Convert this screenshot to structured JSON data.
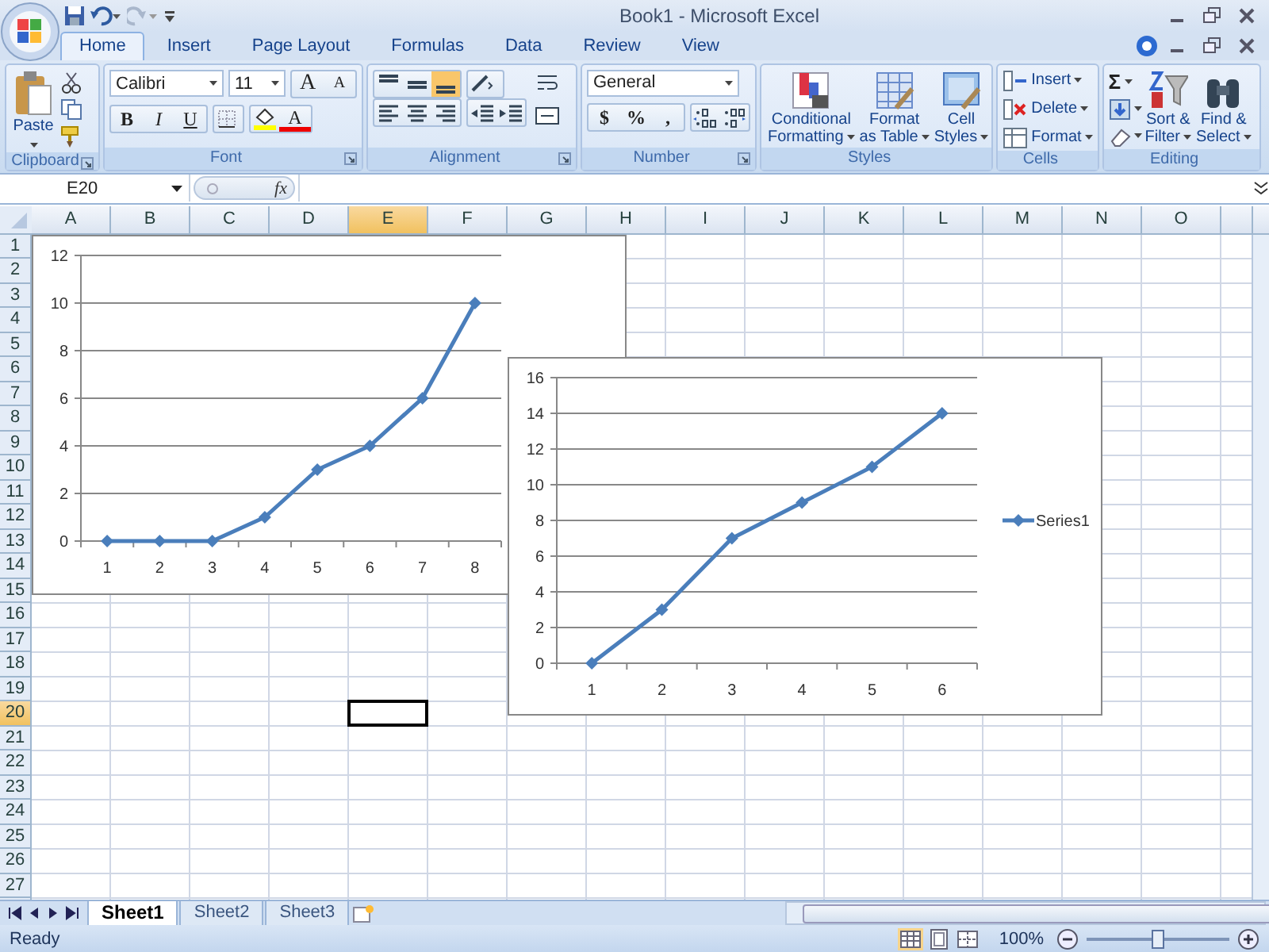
{
  "window": {
    "title": "Book1 - Microsoft Excel"
  },
  "ribbon_tabs": [
    {
      "label": "Home",
      "selected": true
    },
    {
      "label": "Insert",
      "selected": false
    },
    {
      "label": "Page Layout",
      "selected": false
    },
    {
      "label": "Formulas",
      "selected": false
    },
    {
      "label": "Data",
      "selected": false
    },
    {
      "label": "Review",
      "selected": false
    },
    {
      "label": "View",
      "selected": false
    }
  ],
  "ribbon": {
    "groups": [
      {
        "label": "Clipboard",
        "launcher": true,
        "buttons": [
          "Paste"
        ]
      },
      {
        "label": "Font",
        "launcher": true,
        "font": "Calibri",
        "size": "11",
        "buttons": [
          "A",
          "A",
          "B",
          "I",
          "U",
          "A"
        ]
      },
      {
        "label": "Alignment",
        "launcher": true,
        "vertical_align": [
          {
            "selected": false
          },
          {
            "selected": false
          },
          {
            "selected": true
          }
        ]
      },
      {
        "label": "Number",
        "launcher": true,
        "format": "General",
        "buttons": [
          "$",
          "%",
          ","
        ]
      },
      {
        "label": "Styles",
        "launcher": false,
        "buttons": [
          {
            "lines": [
              "Conditional",
              "Formatting"
            ]
          },
          {
            "lines": [
              "Format",
              "as Table"
            ]
          },
          {
            "lines": [
              "Cell",
              "Styles"
            ]
          }
        ]
      },
      {
        "label": "Cells",
        "launcher": false,
        "buttons": [
          {
            "lines": [
              "Insert"
            ]
          },
          {
            "lines": [
              "Delete"
            ]
          },
          {
            "lines": [
              "Format"
            ]
          }
        ]
      },
      {
        "label": "Editing",
        "launcher": false,
        "sum": "Σ",
        "buttons": [
          {
            "lines": [
              "Sort &",
              "Filter"
            ]
          },
          {
            "lines": [
              "Find &",
              "Select"
            ]
          }
        ]
      }
    ]
  },
  "formula_bar": {
    "name_box": "E20",
    "fx": "fx"
  },
  "columns": [
    {
      "label": "A",
      "selected": false
    },
    {
      "label": "B",
      "selected": false
    },
    {
      "label": "C",
      "selected": false
    },
    {
      "label": "D",
      "selected": false
    },
    {
      "label": "E",
      "selected": true
    },
    {
      "label": "F",
      "selected": false
    },
    {
      "label": "G",
      "selected": false
    },
    {
      "label": "H",
      "selected": false
    },
    {
      "label": "I",
      "selected": false
    },
    {
      "label": "J",
      "selected": false
    },
    {
      "label": "K",
      "selected": false
    },
    {
      "label": "L",
      "selected": false
    },
    {
      "label": "M",
      "selected": false
    },
    {
      "label": "N",
      "selected": false
    },
    {
      "label": "O",
      "selected": false
    }
  ],
  "rows": [
    {
      "label": "1",
      "selected": false
    },
    {
      "label": "2",
      "selected": false
    },
    {
      "label": "3",
      "selected": false
    },
    {
      "label": "4",
      "selected": false
    },
    {
      "label": "5",
      "selected": false
    },
    {
      "label": "6",
      "selected": false
    },
    {
      "label": "7",
      "selected": false
    },
    {
      "label": "8",
      "selected": false
    },
    {
      "label": "9",
      "selected": false
    },
    {
      "label": "10",
      "selected": false
    },
    {
      "label": "11",
      "selected": false
    },
    {
      "label": "12",
      "selected": false
    },
    {
      "label": "13",
      "selected": false
    },
    {
      "label": "14",
      "selected": false
    },
    {
      "label": "15",
      "selected": false
    },
    {
      "label": "16",
      "selected": false
    },
    {
      "label": "17",
      "selected": false
    },
    {
      "label": "18",
      "selected": false
    },
    {
      "label": "19",
      "selected": false
    },
    {
      "label": "20",
      "selected": true
    },
    {
      "label": "21",
      "selected": false
    },
    {
      "label": "22",
      "selected": false
    },
    {
      "label": "23",
      "selected": false
    },
    {
      "label": "24",
      "selected": false
    },
    {
      "label": "25",
      "selected": false
    },
    {
      "label": "26",
      "selected": false
    },
    {
      "label": "27",
      "selected": false
    }
  ],
  "charts": [
    {
      "chart_data": {
        "type": "line",
        "grid": true,
        "categories": [
          "1",
          "2",
          "3",
          "4",
          "5",
          "6",
          "7",
          "8"
        ],
        "series": [
          {
            "color": "#4a7ebb",
            "marker": "diamond",
            "values": [
              0,
              0,
              0,
              1,
              3,
              4,
              6,
              10
            ]
          }
        ],
        "ylim": [
          0,
          12
        ],
        "yticks": [
          0,
          2,
          4,
          6,
          8,
          10,
          12
        ]
      }
    },
    {
      "chart_data": {
        "type": "line",
        "grid": true,
        "categories": [
          "1",
          "2",
          "3",
          "4",
          "5",
          "6"
        ],
        "series": [
          {
            "name": "Series1",
            "color": "#4a7ebb",
            "marker": "diamond",
            "values": [
              0,
              3,
              7,
              9,
              11,
              14
            ]
          }
        ],
        "ylim": [
          0,
          16
        ],
        "yticks": [
          0,
          2,
          4,
          6,
          8,
          10,
          12,
          14,
          16
        ]
      }
    }
  ],
  "sheet_tabs": [
    {
      "label": "Sheet1",
      "selected": true
    },
    {
      "label": "Sheet2",
      "selected": false
    },
    {
      "label": "Sheet3",
      "selected": false
    }
  ],
  "status_bar": {
    "status": "Ready",
    "views": [
      {
        "selected": true
      },
      {
        "selected": false
      },
      {
        "selected": false
      }
    ],
    "zoom": "100%",
    "zoom_level": {
      "level": 0.5
    }
  }
}
